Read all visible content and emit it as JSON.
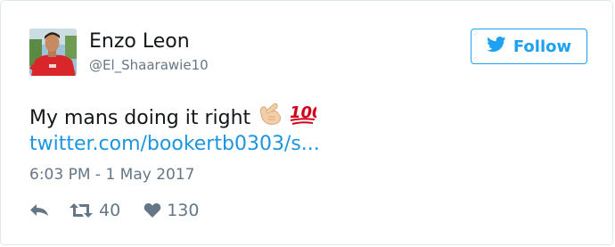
{
  "user": {
    "display_name": "Enzo Leon",
    "handle": "@El_Shaarawie10"
  },
  "follow_button": {
    "label": "Follow",
    "color": "#1da1f2"
  },
  "tweet": {
    "text": "My mans doing it right",
    "emojis": [
      "call-me-hand-emoji",
      "hundred-points-emoji"
    ],
    "link_text": "twitter.com/bookertb0303/s...",
    "link_color": "#1b95e0",
    "timestamp": "6:03 PM - 1 May 2017"
  },
  "actions": {
    "reply_icon": "reply-icon",
    "retweet_icon": "retweet-icon",
    "retweet_count": "40",
    "like_icon": "heart-icon",
    "like_count": "130"
  }
}
